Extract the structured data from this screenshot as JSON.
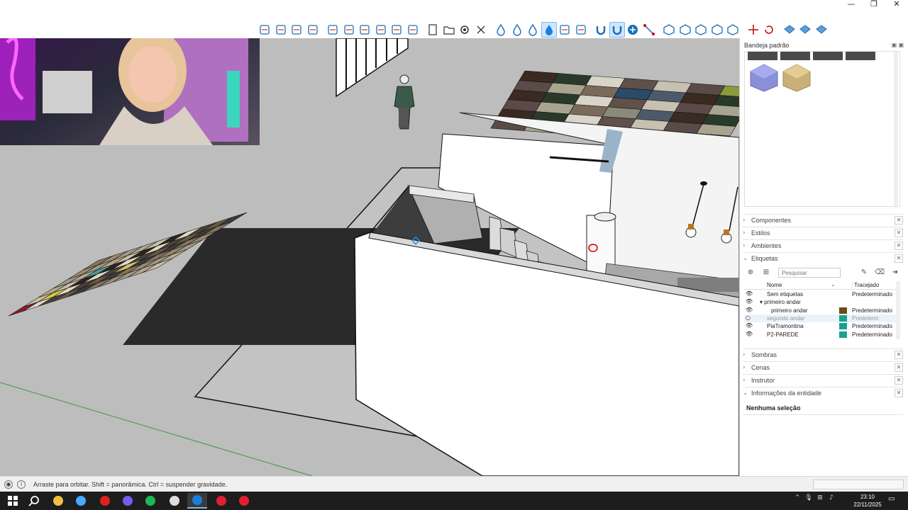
{
  "window": {
    "controls": {
      "minimize": "—",
      "maximize": "❐",
      "close": "✕"
    }
  },
  "toolbar": {
    "tools": [
      {
        "icon": "move-icon"
      },
      {
        "icon": "rotate-icon"
      },
      {
        "icon": "scale-icon"
      },
      {
        "icon": "offset-icon"
      },
      {
        "icon": "orbit-icon"
      },
      {
        "icon": "layer-stack-icon"
      },
      {
        "icon": "layer-stack-icon"
      },
      {
        "icon": "solid-tools-icon"
      },
      {
        "icon": "person-icon"
      },
      {
        "icon": "profile-icon"
      },
      {
        "icon": "page-icon"
      },
      {
        "icon": "folder-icon"
      },
      {
        "icon": "gear-icon"
      },
      {
        "icon": "close-icon"
      },
      {
        "icon": "drop-icon"
      },
      {
        "icon": "drop-icon"
      },
      {
        "icon": "drop-icon"
      },
      {
        "icon": "drop-active-icon"
      },
      {
        "icon": "leaf-icon"
      },
      {
        "icon": "dots-icon"
      },
      {
        "icon": "magnet-icon"
      },
      {
        "icon": "magnet-active-icon"
      },
      {
        "icon": "plus-circle-icon"
      },
      {
        "icon": "line-icon"
      },
      {
        "icon": "cube-icon"
      },
      {
        "icon": "cube-icon"
      },
      {
        "icon": "cube-icon"
      },
      {
        "icon": "cube-icon"
      },
      {
        "icon": "cube-icon"
      },
      {
        "icon": "axes-icon"
      },
      {
        "icon": "refresh-icon"
      },
      {
        "icon": "grid-icon"
      },
      {
        "icon": "grid-icon"
      },
      {
        "icon": "grid-icon"
      }
    ]
  },
  "panel": {
    "title": "Bandeja padrão",
    "sections": {
      "componentes": "Componentes",
      "estilos": "Estilos",
      "ambientes": "Ambientes",
      "etiquetas": "Etiquetas",
      "sombras": "Sombras",
      "cenas": "Cenas",
      "instrutor": "Instrutor",
      "entidade": "Informações da entidade"
    },
    "tags": {
      "search_placeholder": "Pesquisar",
      "col_name": "Nome",
      "col_dash": "Tracejado",
      "rows": [
        {
          "name": "Sem etiquetas",
          "dash": "Predeterminado",
          "color": "",
          "visible": true,
          "indent": 0
        },
        {
          "name": "primeiro andar",
          "dash": "",
          "color": "",
          "visible": true,
          "indent": 0,
          "folder": true
        },
        {
          "name": "primeiro andar",
          "dash": "Predeterminado",
          "color": "#6b4a12",
          "visible": true,
          "indent": 1
        },
        {
          "name": "segundo andar",
          "dash": "Predeterm",
          "color": "#1aa090",
          "visible": false,
          "indent": 0
        },
        {
          "name": "PiaTramontina",
          "dash": "Predeterminado",
          "color": "#1aa090",
          "visible": true,
          "indent": 0
        },
        {
          "name": "P2-PAREDE",
          "dash": "Predeterminado",
          "color": "#1aa090",
          "visible": true,
          "indent": 0
        }
      ]
    },
    "entity": {
      "selection": "Nenhuma seleção"
    }
  },
  "status": {
    "hint": "Arraste para orbitar. Shift = panorâmica. Ctrl = suspender gravidade."
  },
  "taskbar": {
    "time": "23:10",
    "date": "22/11/2025",
    "apps": [
      {
        "icon": "windows-start-icon"
      },
      {
        "icon": "search-icon"
      },
      {
        "icon": "file-explorer-icon"
      },
      {
        "icon": "a-app-icon"
      },
      {
        "icon": "opera-icon"
      },
      {
        "icon": "discord-icon"
      },
      {
        "icon": "spotify-icon"
      },
      {
        "icon": "obs-icon"
      },
      {
        "icon": "sketchup-icon"
      },
      {
        "icon": "red-app-icon"
      },
      {
        "icon": "red-app-icon"
      }
    ]
  },
  "colors": {
    "accent": "#1a7fd8",
    "viewport_ground": "#bdbdbd",
    "wall": "#ffffff"
  }
}
